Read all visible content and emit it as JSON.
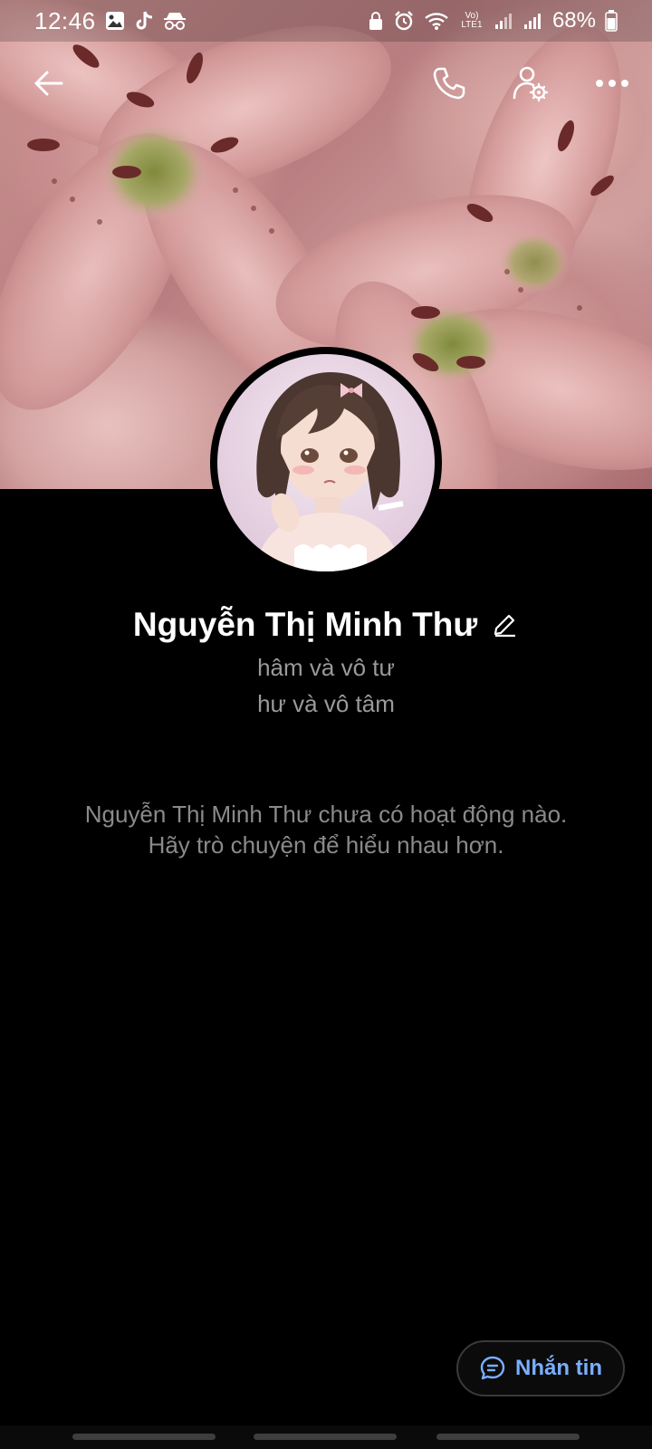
{
  "status_bar": {
    "time": "12:46",
    "battery_percent": "68%",
    "icons_left": [
      "gallery-icon",
      "tiktok-icon",
      "incognito-icon"
    ],
    "icons_right": [
      "vpn-lock-icon",
      "alarm-icon",
      "wifi-icon",
      "volte-icon",
      "signal-icon",
      "signal-icon",
      "battery-icon"
    ],
    "volte_label": "Vo) LTE1"
  },
  "profile": {
    "name": "Nguyễn Thị Minh Thư",
    "bio_lines": [
      "hâm và vô tư",
      "hư và vô tâm"
    ]
  },
  "empty_state": {
    "line1": "Nguyễn Thị Minh Thư chưa có hoạt động nào.",
    "line2": "Hãy trò chuyện để hiểu nhau hơn."
  },
  "actions": {
    "message_label": "Nhắn tin"
  },
  "colors": {
    "background": "#000000",
    "accent": "#7aaeff",
    "muted_text": "#9a9a9a"
  }
}
